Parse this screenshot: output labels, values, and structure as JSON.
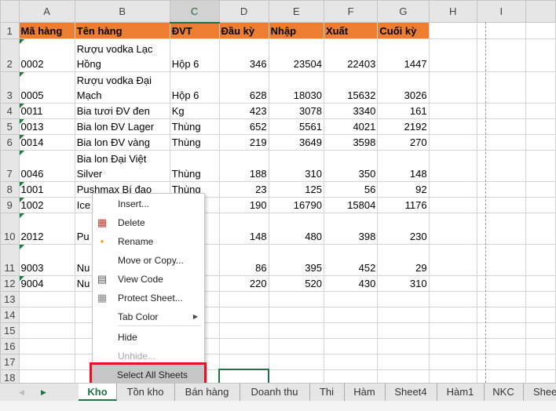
{
  "columns": [
    "A",
    "B",
    "C",
    "D",
    "E",
    "F",
    "G",
    "H",
    "I",
    ""
  ],
  "header_row": {
    "num": "1",
    "cells": [
      "Mã hàng",
      "Tên hàng",
      "ĐVT",
      "Đầu kỳ",
      "Nhập",
      "Xuất",
      "Cuối kỳ"
    ]
  },
  "rows": [
    {
      "num": "2",
      "cells": [
        "0002",
        "Rượu vodka Lạc Hồng",
        "Hộp 6",
        "346",
        "23504",
        "22403",
        "1447"
      ]
    },
    {
      "num": "3",
      "cells": [
        "0005",
        "Rượu vodka Đại Mạch",
        "Hộp 6",
        "628",
        "18030",
        "15632",
        "3026"
      ]
    },
    {
      "num": "4",
      "cells": [
        "0011",
        "Bia tươi ĐV đen",
        "Kg",
        "423",
        "3078",
        "3340",
        "161"
      ]
    },
    {
      "num": "5",
      "cells": [
        "0013",
        "Bia lon ĐV Lager",
        "Thùng",
        "652",
        "5561",
        "4021",
        "2192"
      ]
    },
    {
      "num": "6",
      "cells": [
        "0014",
        "Bia lon ĐV vàng",
        "Thùng",
        "219",
        "3649",
        "3598",
        "270"
      ]
    },
    {
      "num": "7",
      "cells": [
        "0046",
        "Bia lon Đại Việt Silver",
        "Thùng",
        "188",
        "310",
        "350",
        "148"
      ]
    },
    {
      "num": "8",
      "cells": [
        "1001",
        "Pushmax Bí đao",
        "Thùng",
        "23",
        "125",
        "56",
        "92"
      ]
    },
    {
      "num": "9",
      "cells": [
        "1002",
        "Ice",
        "",
        "190",
        "16790",
        "15804",
        "1176"
      ]
    },
    {
      "num": "10",
      "cells": [
        "2012",
        "Pu Ion",
        "",
        "148",
        "480",
        "398",
        "230"
      ]
    },
    {
      "num": "11",
      "cells": [
        "9003",
        "Nu Pu",
        "",
        "86",
        "395",
        "452",
        "29"
      ]
    },
    {
      "num": "12",
      "cells": [
        "9004",
        "Nu",
        "",
        "220",
        "520",
        "430",
        "310"
      ]
    }
  ],
  "empty_rows": [
    "13",
    "14",
    "15",
    "16",
    "17",
    "18"
  ],
  "context_menu": {
    "items": [
      "Insert...",
      "Delete",
      "Rename",
      "Move or Copy...",
      "View Code",
      "Protect Sheet...",
      "Tab Color",
      "Hide",
      "Unhide...",
      "Select All Sheets"
    ]
  },
  "sheet_tabs": [
    "Kho",
    "Tồn kho",
    "Bán hàng",
    "Doanh thu",
    "Thi",
    "Hàm",
    "Sheet4",
    "Hàm1",
    "NKC",
    "Sheet"
  ],
  "nav": {
    "prev": "◀",
    "next": "▶"
  },
  "colors": {
    "accent": "#ED7D31",
    "excel_green": "#217346",
    "highlight_border": "#E81123"
  }
}
